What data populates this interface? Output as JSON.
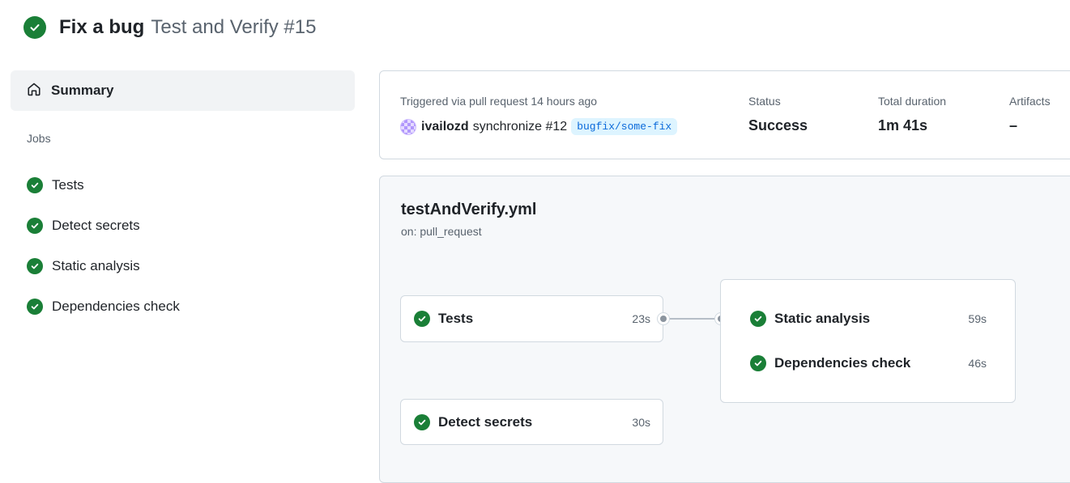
{
  "header": {
    "title": "Fix a bug",
    "subtitle": "Test and Verify #15",
    "status_icon": "check-circle-icon",
    "status_color": "#1a7f37"
  },
  "sidebar": {
    "summary_label": "Summary",
    "jobs_heading": "Jobs",
    "jobs": [
      {
        "label": "Tests",
        "status": "success"
      },
      {
        "label": "Detect secrets",
        "status": "success"
      },
      {
        "label": "Static analysis",
        "status": "success"
      },
      {
        "label": "Dependencies check",
        "status": "success"
      }
    ]
  },
  "run_summary": {
    "trigger_label": "Triggered via pull request 14 hours ago",
    "actor": "ivailozd",
    "action": "synchronize #12",
    "branch": "bugfix/some-fix",
    "status_label": "Status",
    "status_value": "Success",
    "duration_label": "Total duration",
    "duration_value": "1m 41s",
    "artifacts_label": "Artifacts",
    "artifacts_value": "–"
  },
  "workflow": {
    "file": "testAndVerify.yml",
    "trigger": "on: pull_request",
    "jobs": {
      "tests": {
        "name": "Tests",
        "duration": "23s"
      },
      "detect_secrets": {
        "name": "Detect secrets",
        "duration": "30s"
      },
      "static_analysis": {
        "name": "Static analysis",
        "duration": "59s"
      },
      "dependencies_check": {
        "name": "Dependencies check",
        "duration": "46s"
      }
    }
  },
  "colors": {
    "success": "#1a7f37",
    "link": "#0969da",
    "muted": "#59636e"
  }
}
